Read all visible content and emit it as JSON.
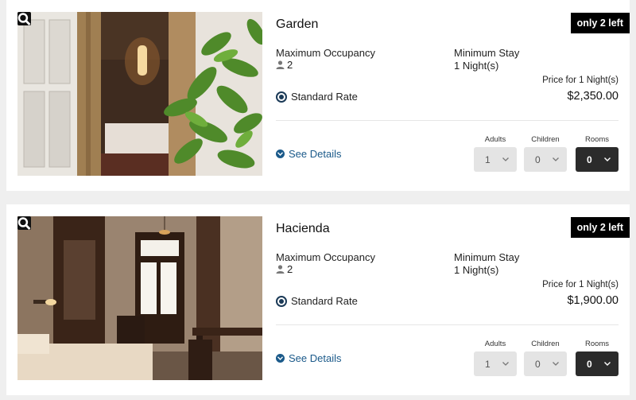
{
  "rooms": [
    {
      "name": "Garden",
      "availability_badge": "only 2 left",
      "occupancy_label": "Maximum Occupancy",
      "occupancy_value": "2",
      "min_stay_label": "Minimum Stay",
      "min_stay_value": "1 Night(s)",
      "rate_name": "Standard Rate",
      "price_label": "Price for 1 Night(s)",
      "price": "$2,350.00",
      "details_link": "See Details",
      "adults_label": "Adults",
      "adults_value": "1",
      "children_label": "Children",
      "children_value": "0",
      "rooms_label": "Rooms",
      "rooms_value": "0"
    },
    {
      "name": "Hacienda",
      "availability_badge": "only 2 left",
      "occupancy_label": "Maximum Occupancy",
      "occupancy_value": "2",
      "min_stay_label": "Minimum Stay",
      "min_stay_value": "1 Night(s)",
      "rate_name": "Standard Rate",
      "price_label": "Price for 1 Night(s)",
      "price": "$1,900.00",
      "details_link": "See Details",
      "adults_label": "Adults",
      "adults_value": "1",
      "children_label": "Children",
      "children_value": "0",
      "rooms_label": "Rooms",
      "rooms_value": "0"
    }
  ],
  "icons": {
    "zoom": "magnifier-icon",
    "guest": "person-icon",
    "details": "chevron-circle-down-icon",
    "select": "chevron-down-icon"
  },
  "colors": {
    "accent_link": "#1b5a8a",
    "radio": "#1b3a57",
    "badge_bg": "#000000",
    "rooms_select_bg": "#2b2b2b"
  }
}
